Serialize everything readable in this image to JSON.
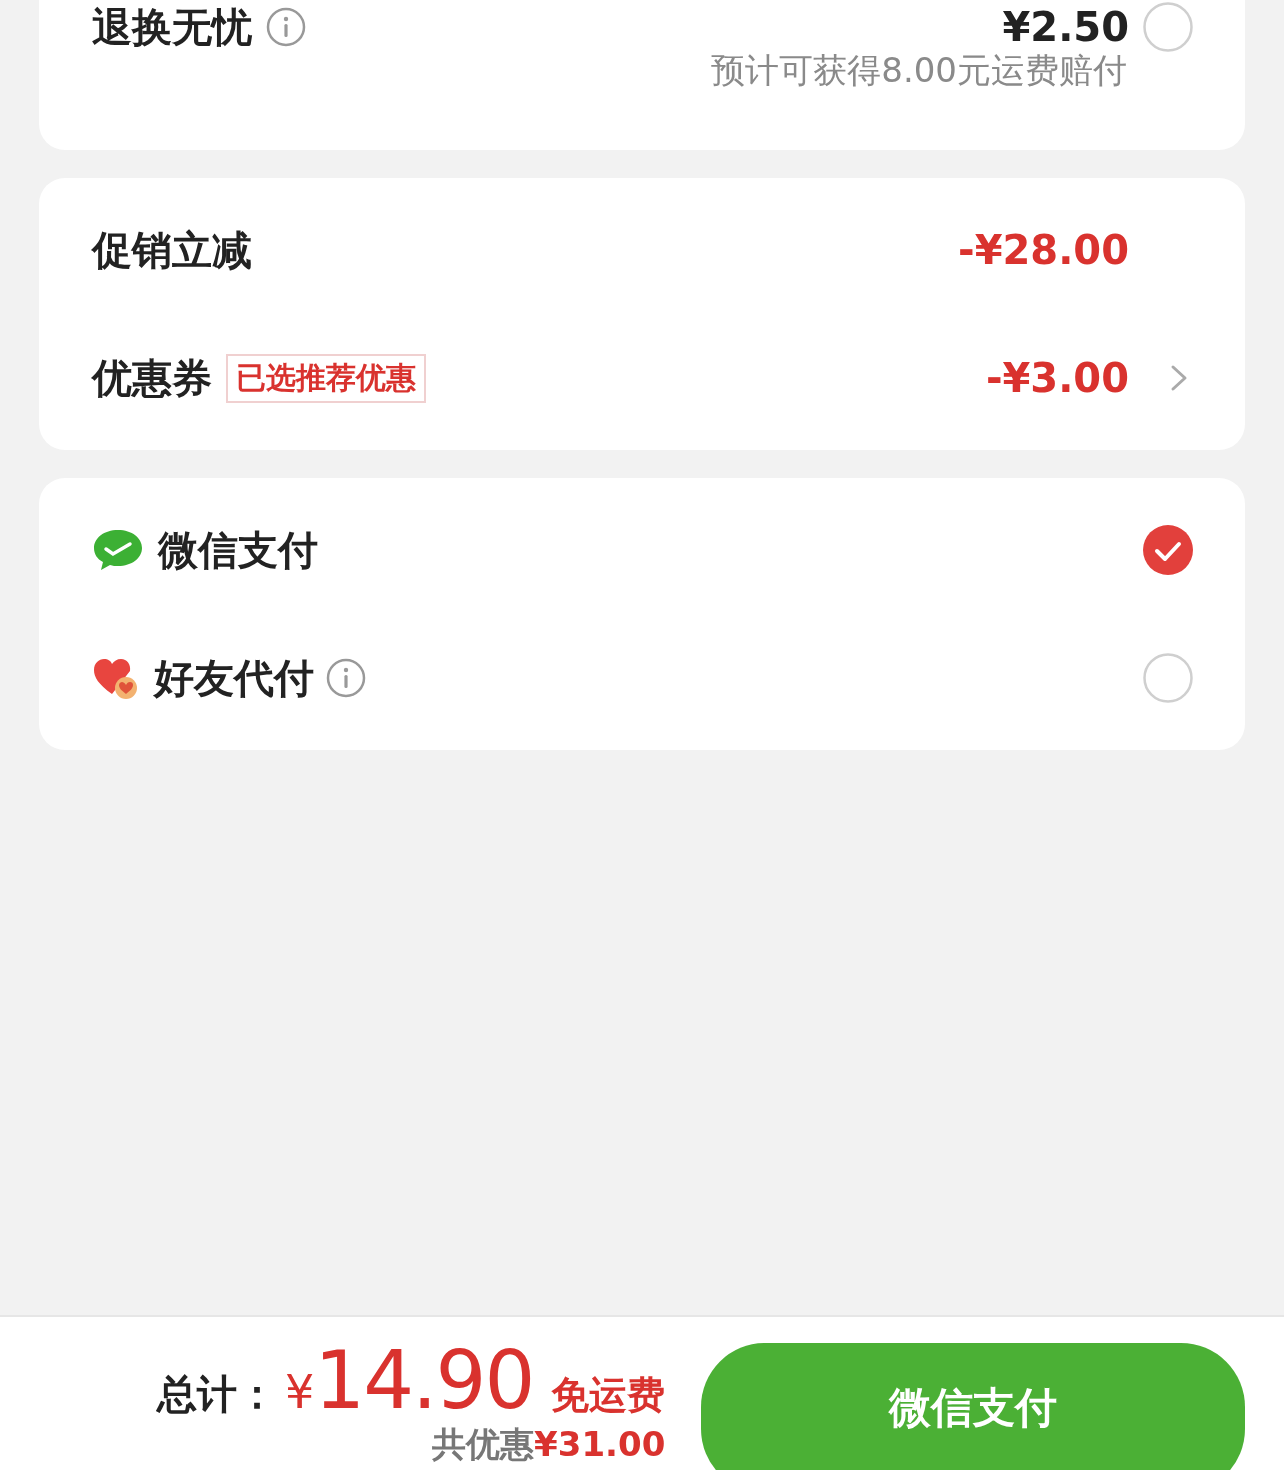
{
  "insurance": {
    "label": "退换无忧",
    "price": "¥2.50",
    "selected": false,
    "note": "预计可获得8.00元运费赔付"
  },
  "discounts": [
    {
      "kind": "promo",
      "label": "促销立减",
      "amount": "-¥28.00"
    },
    {
      "kind": "coupon",
      "label": "优惠券",
      "tag": "已选推荐优惠",
      "amount": "-¥3.00"
    }
  ],
  "payment_methods": [
    {
      "kind": "wechat",
      "label": "微信支付",
      "selected": true
    },
    {
      "kind": "friend",
      "label": "好友代付",
      "selected": false
    }
  ],
  "footer": {
    "total_label": "总计：",
    "currency": "¥",
    "total": "14.90",
    "shipping": "免运费",
    "savings_label": "共优惠",
    "savings": "¥31.00",
    "pay_button": "微信支付"
  }
}
